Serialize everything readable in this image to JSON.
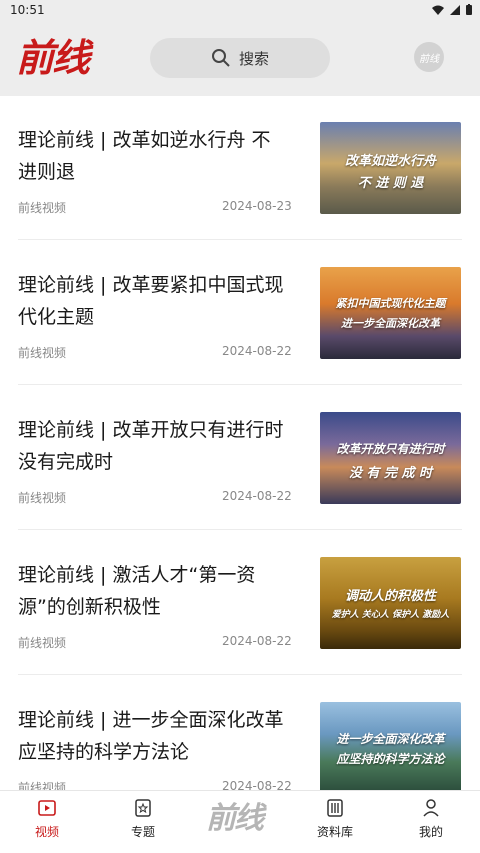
{
  "status_bar": {
    "time": "10:51"
  },
  "header": {
    "logo_text": "前线",
    "search_label": "搜索",
    "avatar_text": "前线"
  },
  "articles": [
    {
      "title": "理论前线 | 改革如逆水行舟 不进则退",
      "source": "前线视频",
      "date": "2024-08-23",
      "thumb_line1": "改革如逆水行舟",
      "thumb_line2": "不 进 则 退"
    },
    {
      "title": "理论前线 | 改革要紧扣中国式现代化主题",
      "source": "前线视频",
      "date": "2024-08-22",
      "thumb_line1": "紧扣中国式现代化主题",
      "thumb_line2": "进一步全面深化改革"
    },
    {
      "title": "理论前线 | 改革开放只有进行时没有完成时",
      "source": "前线视频",
      "date": "2024-08-22",
      "thumb_line1": "改革开放只有进行时",
      "thumb_line2": "没 有 完 成 时"
    },
    {
      "title": "理论前线 | 激活人才“第一资源”的创新积极性",
      "source": "前线视频",
      "date": "2024-08-22",
      "thumb_line1": "调动人的积极性",
      "thumb_line2": "爱护人 关心人 保护人 激励人"
    },
    {
      "title": "理论前线 | 进一步全面深化改革应坚持的科学方法论",
      "source": "前线视频",
      "date": "2024-08-22",
      "thumb_line1": "进一步全面深化改革",
      "thumb_line2": "应坚持的科学方法论"
    }
  ],
  "tabbar": {
    "video": "视频",
    "topics": "专题",
    "logo": "前线",
    "library": "资料库",
    "mine": "我的"
  },
  "colors": {
    "accent": "#c81a1a",
    "header_bg": "#ededed"
  }
}
